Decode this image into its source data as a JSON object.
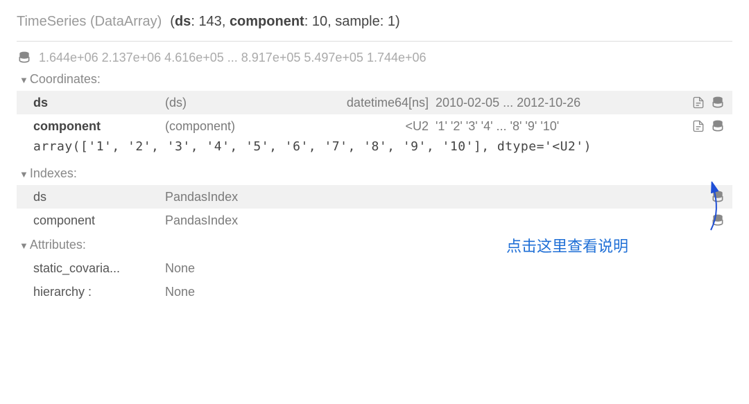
{
  "header": {
    "title": "TimeSeries (DataArray)",
    "dim1_label": "ds",
    "dim1_size": "143",
    "dim2_label": "component",
    "dim2_size": "10",
    "dim3_label": "sample",
    "dim3_size": "1"
  },
  "preview_values": "1.644e+06 2.137e+06 4.616e+05 ... 8.917e+05 5.497e+05 1.744e+06",
  "sections": {
    "coordinates_label": "Coordinates:",
    "indexes_label": "Indexes:",
    "attributes_label": "Attributes:"
  },
  "coords": {
    "ds": {
      "name": "ds",
      "dim": "(ds)",
      "dtype": "datetime64[ns]",
      "values": "2010-02-05 ... 2012-10-26"
    },
    "component": {
      "name": "component",
      "dim": "(component)",
      "dtype": "<U2",
      "values": "'1' '2' '3' '4' ... '8' '9' '10'"
    }
  },
  "component_array_repr": "array(['1', '2', '3', '4', '5', '6', '7', '8', '9', '10'], dtype='<U2')",
  "indexes": {
    "ds": {
      "name": "ds",
      "type": "PandasIndex"
    },
    "component": {
      "name": "component",
      "type": "PandasIndex"
    }
  },
  "attributes": {
    "static_covariates": {
      "label": "static_covaria...",
      "value": "None"
    },
    "hierarchy": {
      "label": "hierarchy :",
      "value": "None"
    }
  },
  "annotation_text": "点击这里查看说明"
}
